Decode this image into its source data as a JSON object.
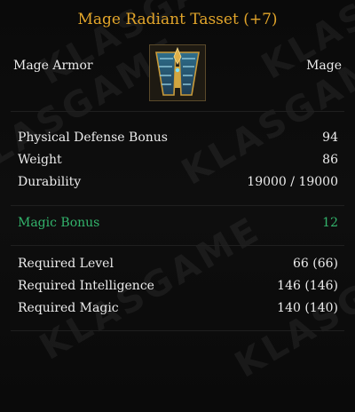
{
  "item": {
    "name": "Mage Radiant Tasset (+7)",
    "type": "Mage Armor",
    "class": "Mage",
    "icon": "tasset-armor-icon"
  },
  "watermark_text": "KLASGAME",
  "stats": [
    {
      "label": "Physical Defense Bonus",
      "value": "94"
    },
    {
      "label": "Weight",
      "value": "86"
    },
    {
      "label": "Durability",
      "value": "19000 / 19000"
    }
  ],
  "bonus": [
    {
      "label": "Magic Bonus",
      "value": "12"
    }
  ],
  "requirements": [
    {
      "label": "Required Level",
      "value": "66 (66)"
    },
    {
      "label": "Required Intelligence",
      "value": "146 (146)"
    },
    {
      "label": "Required Magic",
      "value": "140 (140)"
    }
  ],
  "colors": {
    "title": "#e2a52a",
    "bonus": "#33b46c",
    "text": "#ececec"
  }
}
